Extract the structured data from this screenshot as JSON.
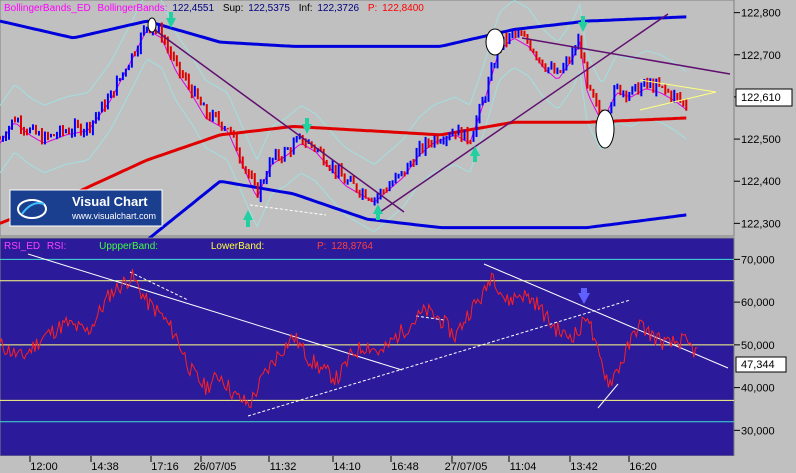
{
  "top_panel": {
    "legend": {
      "indicator": "BollingerBands_ED",
      "series_name": "BollingerBands:",
      "series_value": "122,4551",
      "sup_label": "Sup:",
      "sup_value": "122,5375",
      "inf_label": "Inf:",
      "inf_value": "122,3726",
      "p_label": "P:",
      "p_value": "122,8400"
    },
    "current_price": "122,610",
    "logo": {
      "name": "Visual Chart",
      "url": "www.visualchart.com"
    }
  },
  "bottom_panel": {
    "legend": {
      "indicator": "RSI_ED",
      "series_name": "RSI:",
      "upper_label": "UppperBand:",
      "lower_label": "LowerBand:",
      "p_label": "P:",
      "p_value": "128,8764"
    },
    "current_value": "47,344"
  },
  "time_axis": [
    "12:00",
    "14:38",
    "17:16",
    "26/07/05",
    "11:32",
    "14:10",
    "16:48",
    "27/07/05",
    "11:04",
    "13:42",
    "16:20"
  ],
  "colors": {
    "top_bg": "#c0c0c0",
    "bottom_bg": "#2b1a9a",
    "bull": "#0000ff",
    "bear": "#e00000",
    "band_outer": "#0000dd",
    "band_mid": "#e00000",
    "band_inner": "#a0e0e0",
    "ma_magenta": "#e000e0",
    "trendline": "#601070",
    "rsi_line": "#ff2020",
    "rsi_trend": "#ffffff"
  },
  "chart_data": [
    {
      "type": "candlestick",
      "title": "BollingerBands_ED",
      "ylim": [
        122.27,
        122.83
      ],
      "y_ticks": [
        "122,300",
        "122,400",
        "122,500",
        "122,600",
        "122,700",
        "122,800"
      ],
      "y_tick_values": [
        122.3,
        122.4,
        122.5,
        122.6,
        122.7,
        122.8
      ],
      "close_path": [
        [
          0,
          122.5
        ],
        [
          0.02,
          122.55
        ],
        [
          0.04,
          122.52
        ],
        [
          0.06,
          122.5
        ],
        [
          0.09,
          122.52
        ],
        [
          0.12,
          122.53
        ],
        [
          0.15,
          122.6
        ],
        [
          0.18,
          122.7
        ],
        [
          0.2,
          122.77
        ],
        [
          0.22,
          122.75
        ],
        [
          0.24,
          122.67
        ],
        [
          0.26,
          122.62
        ],
        [
          0.28,
          122.56
        ],
        [
          0.31,
          122.53
        ],
        [
          0.33,
          122.45
        ],
        [
          0.35,
          122.37
        ],
        [
          0.37,
          122.45
        ],
        [
          0.39,
          122.47
        ],
        [
          0.41,
          122.5
        ],
        [
          0.43,
          122.48
        ],
        [
          0.45,
          122.44
        ],
        [
          0.47,
          122.4
        ],
        [
          0.49,
          122.38
        ],
        [
          0.51,
          122.36
        ],
        [
          0.53,
          122.39
        ],
        [
          0.55,
          122.42
        ],
        [
          0.57,
          122.47
        ],
        [
          0.59,
          122.5
        ],
        [
          0.62,
          122.52
        ],
        [
          0.64,
          122.5
        ],
        [
          0.66,
          122.6
        ],
        [
          0.68,
          122.72
        ],
        [
          0.7,
          122.75
        ],
        [
          0.72,
          122.73
        ],
        [
          0.74,
          122.68
        ],
        [
          0.76,
          122.65
        ],
        [
          0.78,
          122.7
        ],
        [
          0.79,
          122.74
        ],
        [
          0.8,
          122.62
        ],
        [
          0.82,
          122.55
        ],
        [
          0.84,
          122.62
        ],
        [
          0.86,
          122.61
        ],
        [
          0.88,
          122.63
        ],
        [
          0.9,
          122.62
        ],
        [
          0.92,
          122.6
        ],
        [
          0.935,
          122.58
        ]
      ],
      "bands": {
        "upper": [
          [
            0,
            122.78
          ],
          [
            0.1,
            122.74
          ],
          [
            0.2,
            122.78
          ],
          [
            0.3,
            122.73
          ],
          [
            0.4,
            122.72
          ],
          [
            0.5,
            122.72
          ],
          [
            0.6,
            122.72
          ],
          [
            0.7,
            122.76
          ],
          [
            0.8,
            122.78
          ],
          [
            0.935,
            122.79
          ]
        ],
        "middle": [
          [
            0,
            122.3
          ],
          [
            0.1,
            122.37
          ],
          [
            0.2,
            122.45
          ],
          [
            0.3,
            122.51
          ],
          [
            0.4,
            122.53
          ],
          [
            0.5,
            122.52
          ],
          [
            0.6,
            122.51
          ],
          [
            0.7,
            122.54
          ],
          [
            0.8,
            122.54
          ],
          [
            0.935,
            122.55
          ]
        ],
        "lower": [
          [
            0,
            122.15
          ],
          [
            0.1,
            122.16
          ],
          [
            0.2,
            122.26
          ],
          [
            0.3,
            122.4
          ],
          [
            0.4,
            122.37
          ],
          [
            0.5,
            122.31
          ],
          [
            0.6,
            122.29
          ],
          [
            0.7,
            122.29
          ],
          [
            0.8,
            122.29
          ],
          [
            0.935,
            122.32
          ]
        ]
      }
    },
    {
      "type": "line",
      "title": "RSI_ED",
      "ylim": [
        24,
        75
      ],
      "y_ticks": [
        "30,000",
        "40,000",
        "50,000",
        "60,000",
        "70,000"
      ],
      "y_tick_values": [
        30,
        40,
        50,
        60,
        70
      ],
      "h_lines": [
        32,
        37,
        50,
        65,
        70
      ],
      "series": [
        {
          "name": "RSI",
          "values": [
            [
              0,
              50
            ],
            [
              0.03,
              47
            ],
            [
              0.06,
              52
            ],
            [
              0.09,
              55
            ],
            [
              0.12,
              53
            ],
            [
              0.15,
              62
            ],
            [
              0.18,
              66
            ],
            [
              0.2,
              60
            ],
            [
              0.22,
              57
            ],
            [
              0.24,
              52
            ],
            [
              0.26,
              44
            ],
            [
              0.28,
              40
            ],
            [
              0.3,
              43
            ],
            [
              0.32,
              38
            ],
            [
              0.34,
              36
            ],
            [
              0.36,
              43
            ],
            [
              0.38,
              48
            ],
            [
              0.4,
              52
            ],
            [
              0.42,
              47
            ],
            [
              0.44,
              44
            ],
            [
              0.46,
              42
            ],
            [
              0.48,
              48
            ],
            [
              0.5,
              50
            ],
            [
              0.52,
              48
            ],
            [
              0.54,
              52
            ],
            [
              0.56,
              55
            ],
            [
              0.58,
              58
            ],
            [
              0.6,
              56
            ],
            [
              0.62,
              52
            ],
            [
              0.64,
              58
            ],
            [
              0.66,
              62
            ],
            [
              0.67,
              67
            ],
            [
              0.69,
              60
            ],
            [
              0.71,
              62
            ],
            [
              0.73,
              60
            ],
            [
              0.75,
              55
            ],
            [
              0.77,
              52
            ],
            [
              0.79,
              53
            ],
            [
              0.8,
              58
            ],
            [
              0.81,
              50
            ],
            [
              0.83,
              41
            ],
            [
              0.85,
              47
            ],
            [
              0.87,
              55
            ],
            [
              0.89,
              52
            ],
            [
              0.91,
              50
            ],
            [
              0.93,
              51
            ],
            [
              0.95,
              48
            ]
          ]
        }
      ]
    }
  ]
}
